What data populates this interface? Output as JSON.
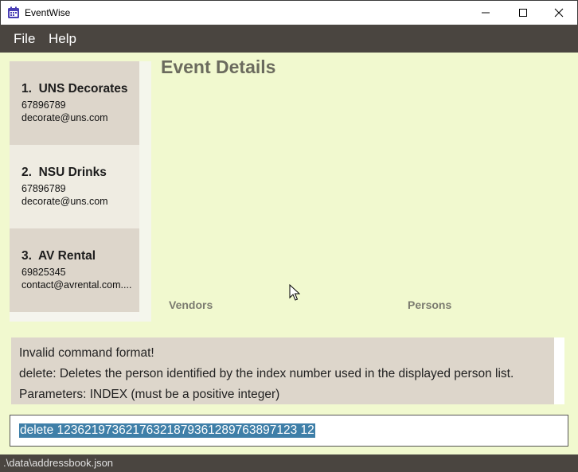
{
  "window": {
    "title": "EventWise"
  },
  "menu": {
    "items": [
      "File",
      "Help"
    ]
  },
  "vendors": [
    {
      "index": "1.",
      "name": "UNS Decorates",
      "phone": "67896789",
      "email": "decorate@uns.com"
    },
    {
      "index": "2.",
      "name": "NSU Drinks",
      "phone": "67896789",
      "email": "decorate@uns.com"
    },
    {
      "index": "3.",
      "name": "AV Rental",
      "phone": "69825345",
      "email": "contact@avrental.com...."
    }
  ],
  "details": {
    "title": "Event Details",
    "vendors_label": "Vendors",
    "persons_label": "Persons"
  },
  "result": {
    "lines": [
      "Invalid command format!",
      "delete: Deletes the person identified by the index number used in the displayed person list.",
      "Parameters: INDEX (must be a positive integer)"
    ]
  },
  "command": {
    "value": "delete 12362197362176321879361289763897123 12"
  },
  "status": {
    "path": ".\\data\\addressbook.json"
  },
  "colors": {
    "background": "#f1f9cf",
    "dark": "#4a4540",
    "card_selected": "#ddd6cb",
    "card_plain": "#efece2",
    "highlight": "#3f7fa8"
  }
}
